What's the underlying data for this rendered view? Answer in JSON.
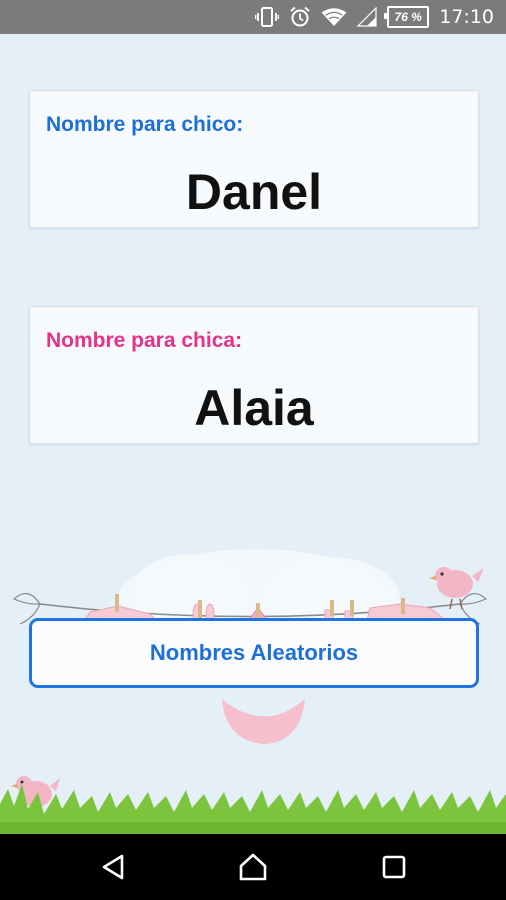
{
  "status_bar": {
    "battery": "76 %",
    "time": "17:10",
    "icons": [
      "vibrate-icon",
      "alarm-icon",
      "wifi-icon",
      "signal-icon",
      "battery-icon"
    ]
  },
  "boy_card": {
    "label": "Nombre para chico:",
    "name": "Danel"
  },
  "girl_card": {
    "label": "Nombre para chica:",
    "name": "Alaia"
  },
  "random_button": {
    "label": "Nombres Aleatorios"
  },
  "nav_bar": {
    "icons": [
      "back-icon",
      "home-icon",
      "recents-icon"
    ]
  },
  "colors": {
    "boy_accent": "#1e6fd8",
    "girl_accent": "#e3338a",
    "background": "#e4eff8",
    "grass": "#7cc43d"
  }
}
